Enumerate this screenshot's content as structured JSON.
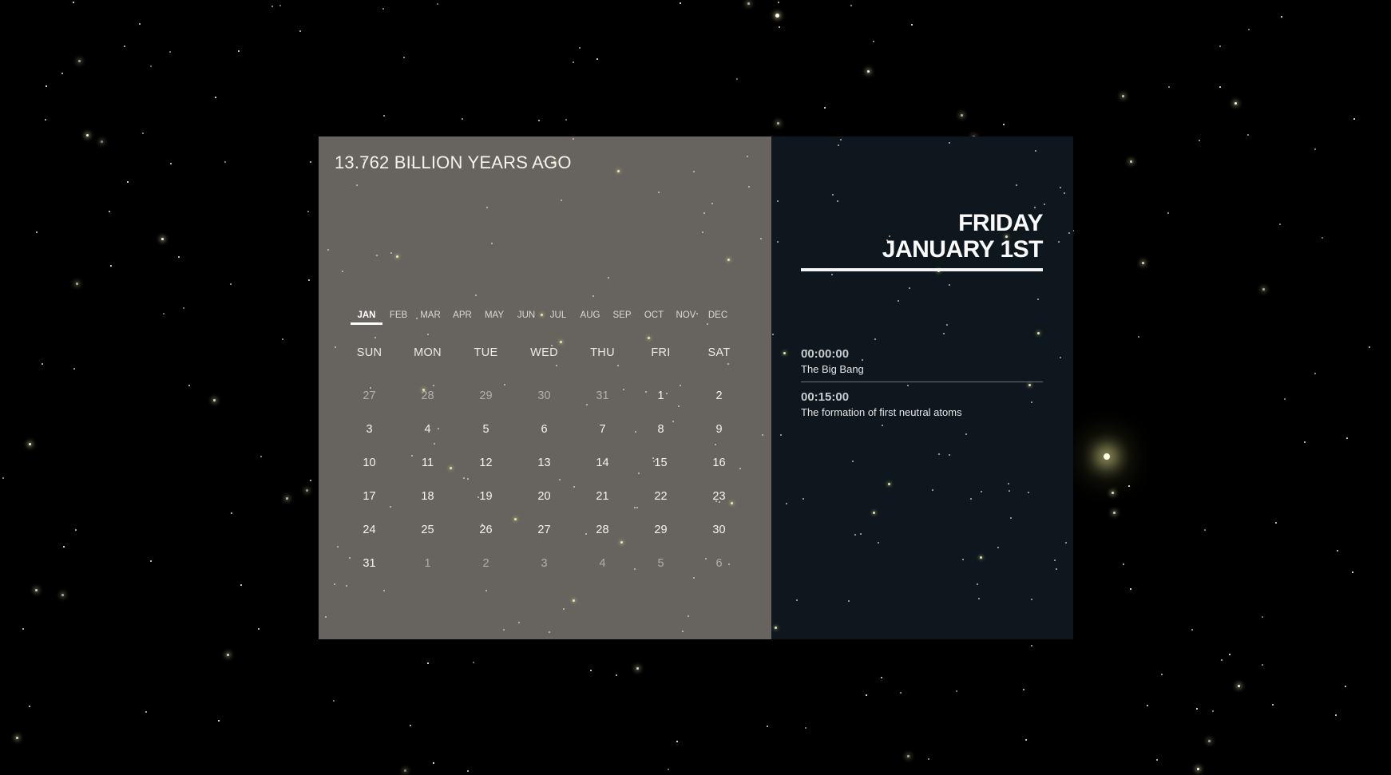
{
  "header": {
    "time_ago": "13.762 BILLION YEARS AGO"
  },
  "months": [
    "JAN",
    "FEB",
    "MAR",
    "APR",
    "MAY",
    "JUN",
    "JUL",
    "AUG",
    "SEP",
    "OCT",
    "NOV",
    "DEC"
  ],
  "active_month": "JAN",
  "weekdays": [
    "SUN",
    "MON",
    "TUE",
    "WED",
    "THU",
    "FRI",
    "SAT"
  ],
  "days": [
    {
      "label": "27",
      "outside": true
    },
    {
      "label": "28",
      "outside": true
    },
    {
      "label": "29",
      "outside": true
    },
    {
      "label": "30",
      "outside": true
    },
    {
      "label": "31",
      "outside": true
    },
    {
      "label": "1",
      "outside": false
    },
    {
      "label": "2",
      "outside": false
    },
    {
      "label": "3",
      "outside": false
    },
    {
      "label": "4",
      "outside": false
    },
    {
      "label": "5",
      "outside": false
    },
    {
      "label": "6",
      "outside": false
    },
    {
      "label": "7",
      "outside": false
    },
    {
      "label": "8",
      "outside": false
    },
    {
      "label": "9",
      "outside": false
    },
    {
      "label": "10",
      "outside": false
    },
    {
      "label": "11",
      "outside": false
    },
    {
      "label": "12",
      "outside": false
    },
    {
      "label": "13",
      "outside": false
    },
    {
      "label": "14",
      "outside": false
    },
    {
      "label": "15",
      "outside": false
    },
    {
      "label": "16",
      "outside": false
    },
    {
      "label": "17",
      "outside": false
    },
    {
      "label": "18",
      "outside": false
    },
    {
      "label": "19",
      "outside": false
    },
    {
      "label": "20",
      "outside": false
    },
    {
      "label": "21",
      "outside": false
    },
    {
      "label": "22",
      "outside": false
    },
    {
      "label": "23",
      "outside": false
    },
    {
      "label": "24",
      "outside": false
    },
    {
      "label": "25",
      "outside": false
    },
    {
      "label": "26",
      "outside": false
    },
    {
      "label": "27",
      "outside": false
    },
    {
      "label": "28",
      "outside": false
    },
    {
      "label": "29",
      "outside": false
    },
    {
      "label": "30",
      "outside": false
    },
    {
      "label": "31",
      "outside": false
    },
    {
      "label": "1",
      "outside": true
    },
    {
      "label": "2",
      "outside": true
    },
    {
      "label": "3",
      "outside": true
    },
    {
      "label": "4",
      "outside": true
    },
    {
      "label": "5",
      "outside": true
    },
    {
      "label": "6",
      "outside": true
    }
  ],
  "selected": {
    "weekday": "FRIDAY",
    "date": "JANUARY 1ST"
  },
  "events": [
    {
      "time": "00:00:00",
      "description": "The Big Bang"
    },
    {
      "time": "00:15:00",
      "description": "The formation of first neutral atoms"
    }
  ],
  "colors": {
    "background": "#000000",
    "calendar_panel": "#67635e",
    "event_panel": "#0d171d",
    "star": "#fffbe0"
  }
}
